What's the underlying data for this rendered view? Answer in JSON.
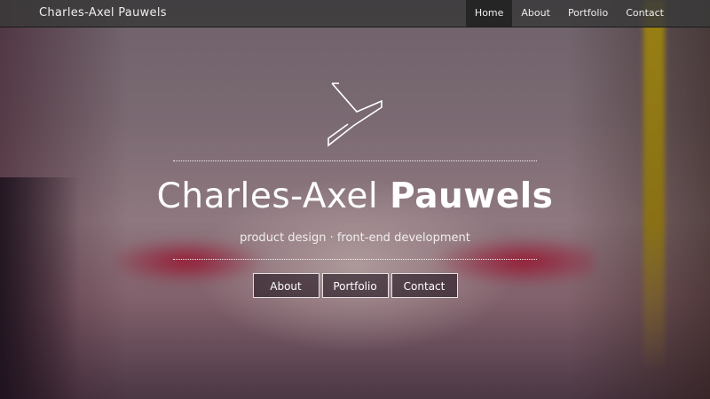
{
  "navbar": {
    "brand": "Charles-Axel Pauwels",
    "items": [
      {
        "label": "Home",
        "active": true
      },
      {
        "label": "About",
        "active": false
      },
      {
        "label": "Portfolio",
        "active": false
      },
      {
        "label": "Contact",
        "active": false
      }
    ]
  },
  "hero": {
    "logo_icon": "chevron-logo-icon",
    "title_first": "Charles-Axel",
    "title_last": "Pauwels",
    "tagline": "product design · front-end development",
    "buttons": [
      {
        "label": "About"
      },
      {
        "label": "Portfolio"
      },
      {
        "label": "Contact"
      }
    ]
  },
  "colors": {
    "navbar_bg": "#3a3a3a",
    "active_nav_bg": "#252525",
    "text": "#ffffff"
  }
}
